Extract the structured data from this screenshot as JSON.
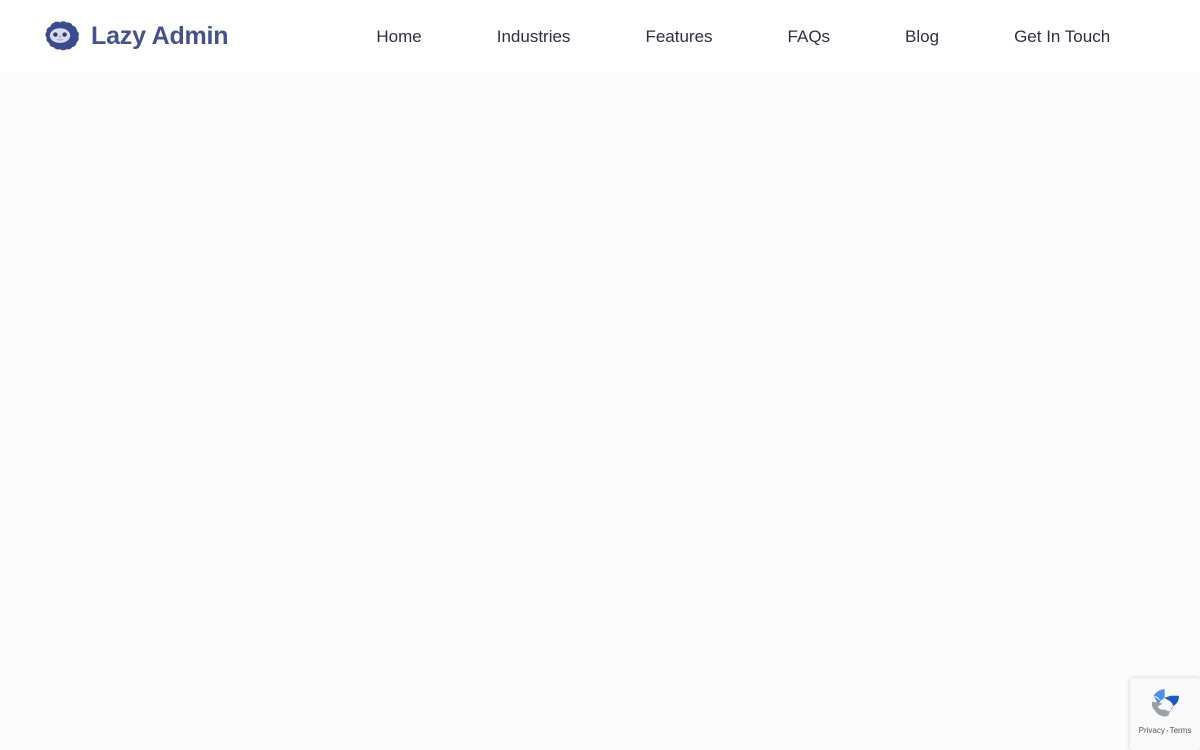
{
  "header": {
    "brand": {
      "name": "Lazy Admin",
      "logo_icon": "cloud-face-logo-icon",
      "color": "#44538c"
    },
    "nav": {
      "items": [
        {
          "label": "Home"
        },
        {
          "label": "Industries"
        },
        {
          "label": "Features"
        },
        {
          "label": "FAQs"
        },
        {
          "label": "Blog"
        },
        {
          "label": "Get In Touch"
        }
      ],
      "link_color": "#2b2f44"
    },
    "background": "#ffffff"
  },
  "main": {
    "content": "",
    "background": "#fcfcfd"
  },
  "recaptcha": {
    "icon": "recaptcha-pinwheel-icon",
    "privacy_label": "Privacy",
    "separator": "-",
    "terms_label": "Terms",
    "colors": {
      "light_blue": "#4a90e8",
      "dark_blue": "#1b5cc0",
      "gray": "#9aa0a6",
      "background": "#f9f9f9"
    }
  }
}
